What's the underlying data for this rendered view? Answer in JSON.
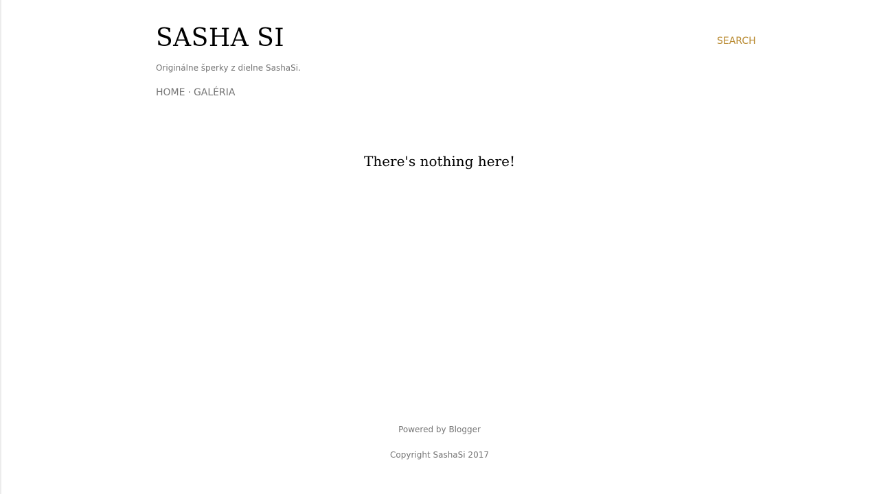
{
  "header": {
    "title": "SASHA SI",
    "description": "Originálne šperky z dielne SashaSi.",
    "search_label": "SEARCH"
  },
  "nav": {
    "items": [
      {
        "label": "HOME"
      },
      {
        "label": "GALÉRIA"
      }
    ],
    "separator": "·"
  },
  "main": {
    "empty_message": "There's nothing here!"
  },
  "footer": {
    "powered_prefix": "Powered by",
    "powered_link": "Blogger",
    "copyright": "Copyright SashaSi 2017"
  },
  "colors": {
    "accent": "#b8892f",
    "muted_text": "#757575",
    "title": "#000000"
  }
}
